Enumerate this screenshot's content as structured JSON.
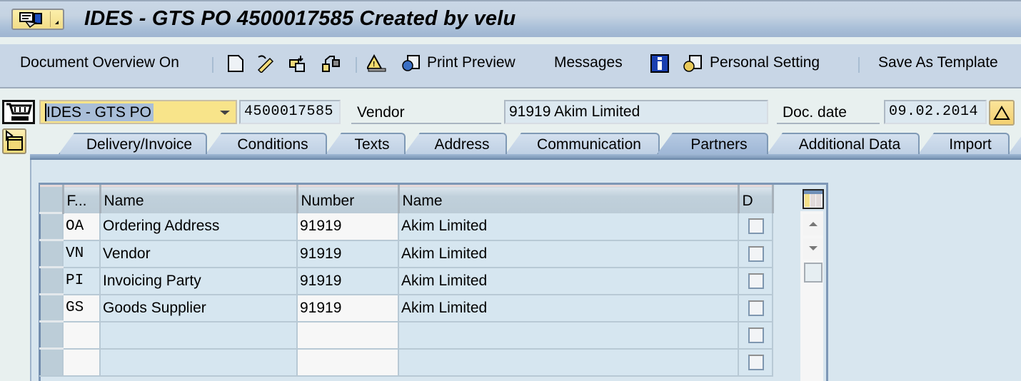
{
  "window": {
    "title": "IDES - GTS PO 4500017585 Created by velu"
  },
  "toolbar": {
    "document_overview": "Document Overview On",
    "icons": [
      "new-document-icon",
      "hold-icon",
      "copy-icon",
      "other-document-icon",
      "check-icon"
    ],
    "print_preview": "Print Preview",
    "messages": "Messages",
    "info_icon": "info-icon",
    "personal_setting": "Personal Setting",
    "save_as_template": "Save As Template"
  },
  "header": {
    "doc_type": "IDES - GTS PO",
    "po_number": "4500017585",
    "vendor_label": "Vendor",
    "vendor_value": "91919 Akim Limited",
    "doc_date_label": "Doc. date",
    "doc_date_value": "09.02.2014"
  },
  "tabs": [
    {
      "label": "Delivery/Invoice",
      "active": false
    },
    {
      "label": "Conditions",
      "active": false
    },
    {
      "label": "Texts",
      "active": false
    },
    {
      "label": "Address",
      "active": false
    },
    {
      "label": "Communication",
      "active": false
    },
    {
      "label": "Partners",
      "active": true
    },
    {
      "label": "Additional Data",
      "active": false
    },
    {
      "label": "Import",
      "active": false
    }
  ],
  "partners_table": {
    "columns": [
      "F...",
      "Name",
      "Number",
      "Name",
      "D"
    ],
    "rows": [
      {
        "function": "OA",
        "function_name": "Ordering Address",
        "number": "91919",
        "partner_name": "Akim Limited",
        "default": false
      },
      {
        "function": "VN",
        "function_name": "Vendor",
        "number": "91919",
        "partner_name": "Akim Limited",
        "default": false
      },
      {
        "function": "PI",
        "function_name": "Invoicing Party",
        "number": "91919",
        "partner_name": "Akim Limited",
        "default": false
      },
      {
        "function": "GS",
        "function_name": "Goods Supplier",
        "number": "91919",
        "partner_name": "Akim Limited",
        "default": false
      },
      {
        "function": "",
        "function_name": "",
        "number": "",
        "partner_name": "",
        "default": false
      },
      {
        "function": "",
        "function_name": "",
        "number": "",
        "partner_name": "",
        "default": false
      }
    ]
  }
}
